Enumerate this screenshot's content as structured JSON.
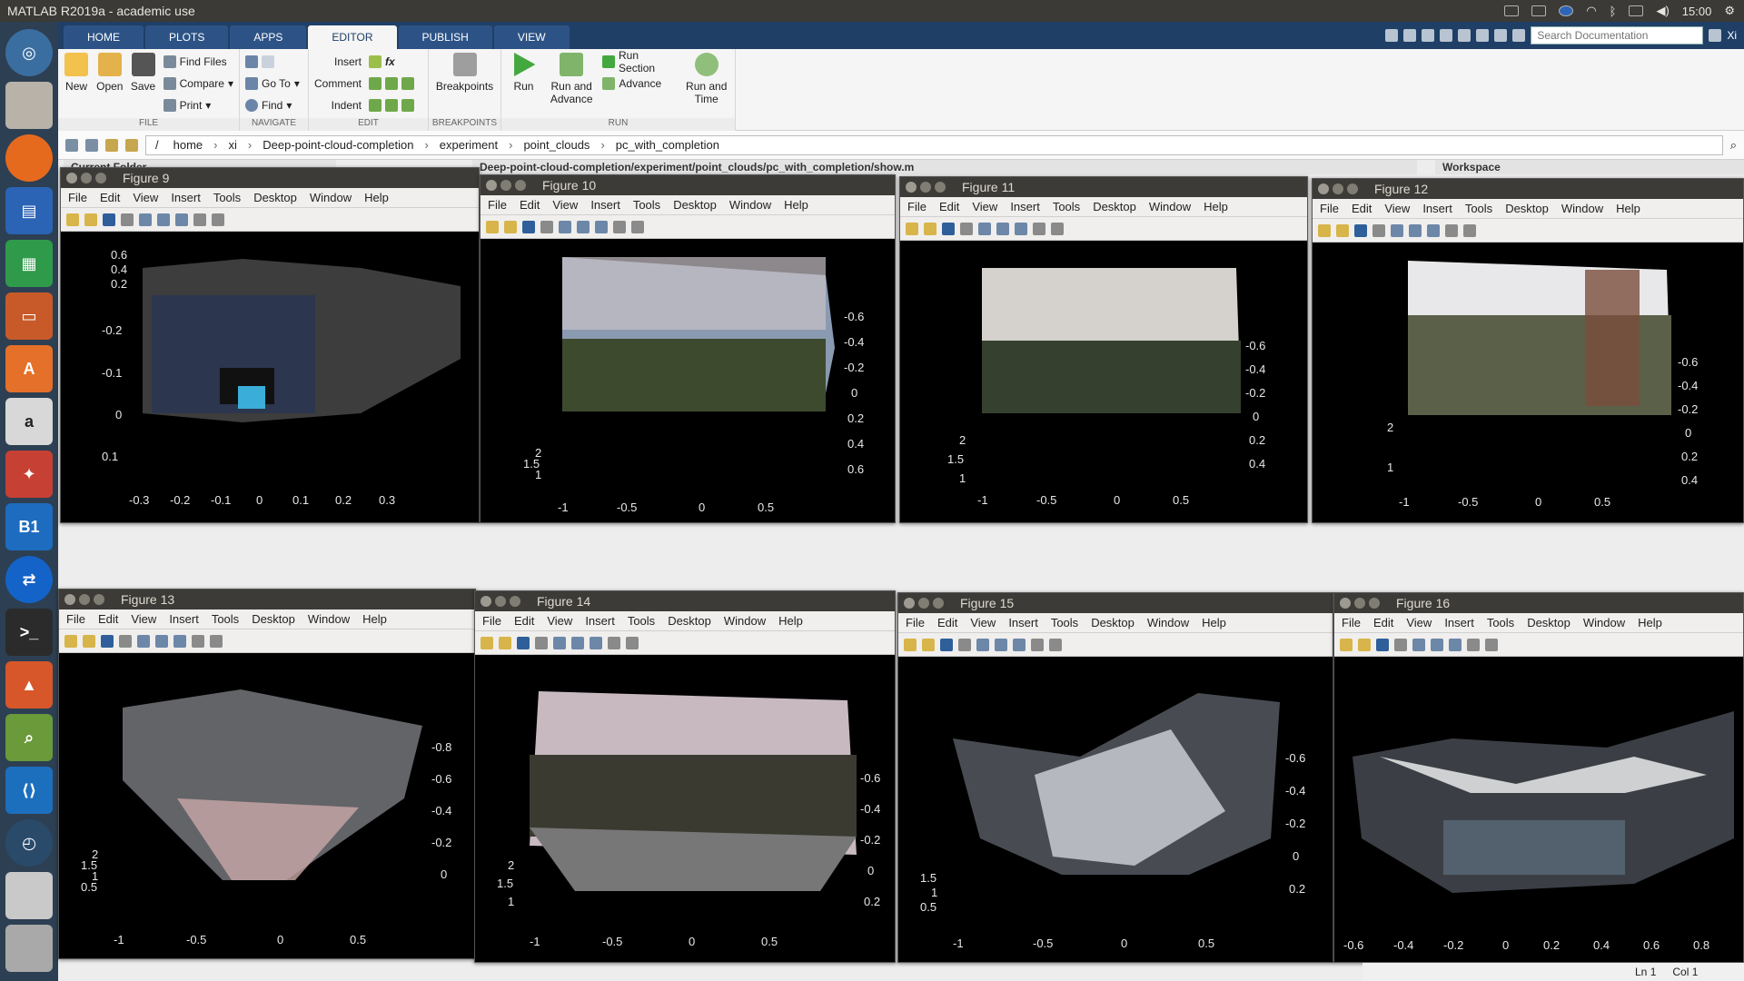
{
  "window_title": "MATLAB R2019a - academic use",
  "clock": "15:00",
  "user": "Xi",
  "tabs": [
    "HOME",
    "PLOTS",
    "APPS",
    "EDITOR",
    "PUBLISH",
    "VIEW"
  ],
  "search_placeholder": "Search Documentation",
  "ribbon": {
    "file": {
      "label": "FILE",
      "new": "New",
      "open": "Open",
      "save": "Save",
      "find_files": "Find Files",
      "compare": "Compare",
      "print": "Print"
    },
    "navigate": {
      "label": "NAVIGATE",
      "go_to": "Go To",
      "find": "Find"
    },
    "edit": {
      "label": "EDIT",
      "insert": "Insert",
      "comment": "Comment",
      "indent": "Indent",
      "fx": "fx"
    },
    "breakpoints": {
      "label": "BREAKPOINTS",
      "breakpoints": "Breakpoints"
    },
    "run": {
      "label": "RUN",
      "run": "Run",
      "run_and_advance": "Run and Advance",
      "run_section": "Run Section",
      "advance": "Advance",
      "run_and_time": "Run and Time"
    }
  },
  "breadcrumb": [
    "/",
    "home",
    "xi",
    "Deep-point-cloud-completion",
    "experiment",
    "point_clouds",
    "pc_with_completion"
  ],
  "panels": {
    "current_folder": "Current Folder",
    "editor_path": "Deep-point-cloud-completion/experiment/point_clouds/pc_with_completion/show.m",
    "workspace": "Workspace"
  },
  "figure_menu": [
    "File",
    "Edit",
    "View",
    "Insert",
    "Tools",
    "Desktop",
    "Window",
    "Help"
  ],
  "figures": [
    {
      "title": "Figure 9",
      "xticks": [
        "-0.3",
        "-0.2",
        "-0.1",
        "0",
        "0.1",
        "0.2",
        "0.3"
      ],
      "yticks": [
        "0.6",
        "0.4",
        "0.2",
        "-0.2",
        "-0.1",
        "0",
        "0.1"
      ],
      "zticks": []
    },
    {
      "title": "Figure 10",
      "xticks": [
        "-1",
        "-0.5",
        "0",
        "0.5"
      ],
      "yticks": [
        "2",
        "1.5",
        "1"
      ],
      "zticks": [
        "-0.6",
        "-0.4",
        "-0.2",
        "0",
        "0.2",
        "0.4",
        "0.6"
      ]
    },
    {
      "title": "Figure 11",
      "xticks": [
        "-1",
        "-0.5",
        "0",
        "0.5"
      ],
      "yticks": [
        "2",
        "1.5",
        "1"
      ],
      "zticks": [
        "-0.6",
        "-0.4",
        "-0.2",
        "0",
        "0.2",
        "0.4"
      ]
    },
    {
      "title": "Figure 12",
      "xticks": [
        "-1",
        "-0.5",
        "0",
        "0.5"
      ],
      "yticks": [
        "2",
        "1"
      ],
      "zticks": [
        "-0.6",
        "-0.4",
        "-0.2",
        "0",
        "0.2",
        "0.4"
      ]
    },
    {
      "title": "Figure 13",
      "xticks": [
        "-1",
        "-0.5",
        "0",
        "0.5"
      ],
      "yticks": [
        "2",
        "1.5",
        "1",
        "0.5"
      ],
      "zticks": [
        "-0.8",
        "-0.6",
        "-0.4",
        "-0.2",
        "0"
      ]
    },
    {
      "title": "Figure 14",
      "xticks": [
        "-1",
        "-0.5",
        "0",
        "0.5"
      ],
      "yticks": [
        "2",
        "1.5",
        "1"
      ],
      "zticks": [
        "-0.6",
        "-0.4",
        "-0.2",
        "0",
        "0.2"
      ]
    },
    {
      "title": "Figure 15",
      "xticks": [
        "-1",
        "-0.5",
        "0",
        "0.5"
      ],
      "yticks": [
        "1.5",
        "1",
        "0.5"
      ],
      "zticks": [
        "-0.6",
        "-0.4",
        "-0.2",
        "0",
        "0.2"
      ]
    },
    {
      "title": "Figure 16",
      "xticks": [
        "-0.6",
        "-0.4",
        "-0.2",
        "0",
        "0.2",
        "0.4",
        "0.6",
        "0.8"
      ],
      "yticks": [],
      "zticks": []
    }
  ],
  "status": {
    "ln_label": "Ln",
    "ln": "1",
    "col_label": "Col",
    "col": "1"
  }
}
